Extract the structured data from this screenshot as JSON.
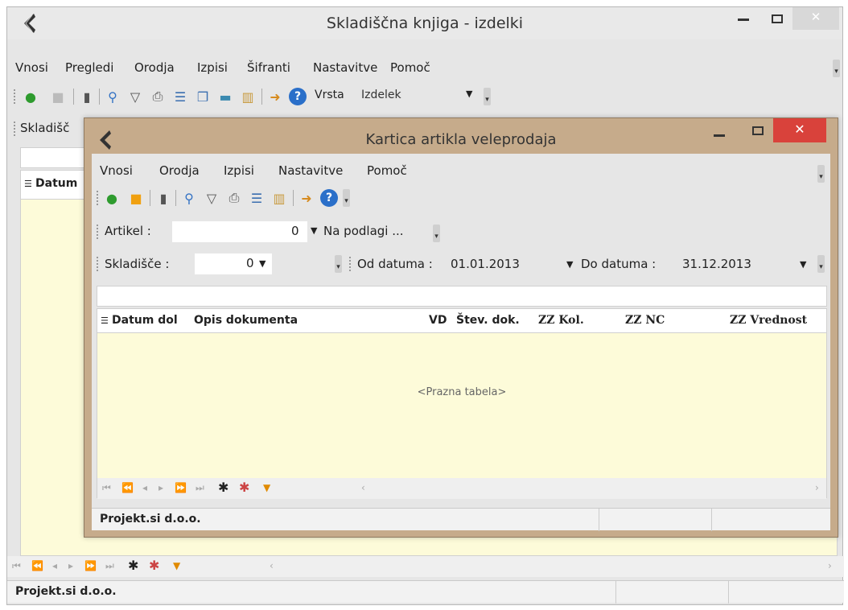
{
  "main": {
    "title": "Skladiščna knjiga - izdelki",
    "menu": [
      "Vnosi",
      "Pregledi",
      "Orodja",
      "Izpisi",
      "Šifranti",
      "Nastavitve",
      "Pomoč"
    ],
    "vrsta_label": "Vrsta",
    "vrsta_value": "Izdelek",
    "sklad_label_partial": "Skladišč",
    "col_datum": "Datum",
    "status": "Projekt.si d.o.o."
  },
  "child": {
    "title": "Kartica artikla veleprodaja",
    "menu": [
      "Vnosi",
      "Orodja",
      "Izpisi",
      "Nastavitve",
      "Pomoč"
    ],
    "artikel_label": "Artikel :",
    "artikel_value": "0",
    "na_podlagi": "Na podlagi ...",
    "skladisce_label": "Skladišče :",
    "skladisce_value": "0",
    "od_label": "Od datuma :",
    "od_value": "01.01.2013",
    "do_label": "Do datuma :",
    "do_value": "31.12.2013",
    "columns": [
      "Datum dol",
      "Opis dokumenta",
      "VD",
      "Štev. dok.",
      "ZZ Kol.",
      "ZZ NC",
      "ZZ Vrednost"
    ],
    "empty": "<Prazna tabela>",
    "status": "Projekt.si d.o.o."
  },
  "colors": {
    "grid_bg": "#fdfbd9",
    "child_frame": "#c6ab8b",
    "close_red": "#d9423b"
  }
}
